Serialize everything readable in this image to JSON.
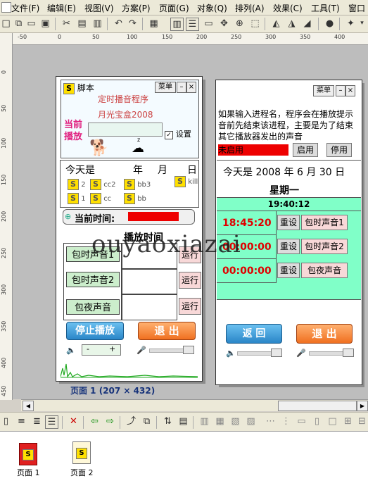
{
  "menubar": {
    "items": [
      "文件(F)",
      "编辑(E)",
      "视图(V)",
      "方案(P)",
      "页面(G)",
      "对象(Q)",
      "排列(A)",
      "效果(C)",
      "工具(T)",
      "窗口"
    ]
  },
  "ruler": {
    "h_labels": [
      "-50",
      "0",
      "50",
      "100",
      "150",
      "200",
      "250",
      "300",
      "350",
      "400"
    ],
    "v_labels": [
      "0",
      "50",
      "100",
      "150",
      "200",
      "250",
      "300",
      "350",
      "400",
      "450"
    ]
  },
  "page1": {
    "title": "脚本",
    "menu_btn": "菜单",
    "banner_line1": "定时播音程序",
    "banner_line2": "月光宝盒2008",
    "current_play_1": "当前",
    "current_play_2": "播放",
    "settings": "设置",
    "zzz": "z",
    "today_label": "今天是",
    "year": "年",
    "month": "月",
    "day": "日",
    "song_items": [
      "2",
      "cc2",
      "bb3",
      "kill",
      "1",
      "cc",
      "bb"
    ],
    "current_time_label": "当前时间:",
    "play_time_header": "播放时间",
    "btn_bell1": "包时声音1",
    "btn_bell2": "包时声音2",
    "btn_night": "包夜声音",
    "run1": "运行",
    "run2": "运行",
    "run3": "运行",
    "stop_btn": "停止播放",
    "exit_btn": "退 出",
    "minus": "-",
    "plus": "+",
    "caption": "页面 1 (207 × 432)"
  },
  "page2": {
    "menu_btn": "菜单",
    "info_text": "如果输入进程名，程序会在播放提示音前先结束该进程，主要是为了结束其它播放器发出的声音",
    "not_enabled": "未启用",
    "enable_btn": "启用",
    "disable_btn": "停用",
    "today_prefix": "今天是",
    "year_value": "2008",
    "year": "年",
    "month_value": "6",
    "month": "月",
    "day_value": "30",
    "day": "日",
    "weekday": "星期一",
    "clock": "19:40:12",
    "time1": "18:45:20",
    "time2": "00:00:00",
    "time3": "00:00:00",
    "reset": "重设",
    "btn_bell1": "包时声音1",
    "btn_bell2": "包时声音2",
    "btn_night": "包夜声音",
    "back_btn": "返 回",
    "exit_btn": "退 出"
  },
  "watermark": "ouyaoxiazai",
  "pages_panel": {
    "items": [
      "页面 1",
      "页面 2"
    ]
  },
  "colors": {
    "accent_green": "#80ffc8",
    "red_bar": "#ee0000",
    "time_red": "#e00000"
  }
}
